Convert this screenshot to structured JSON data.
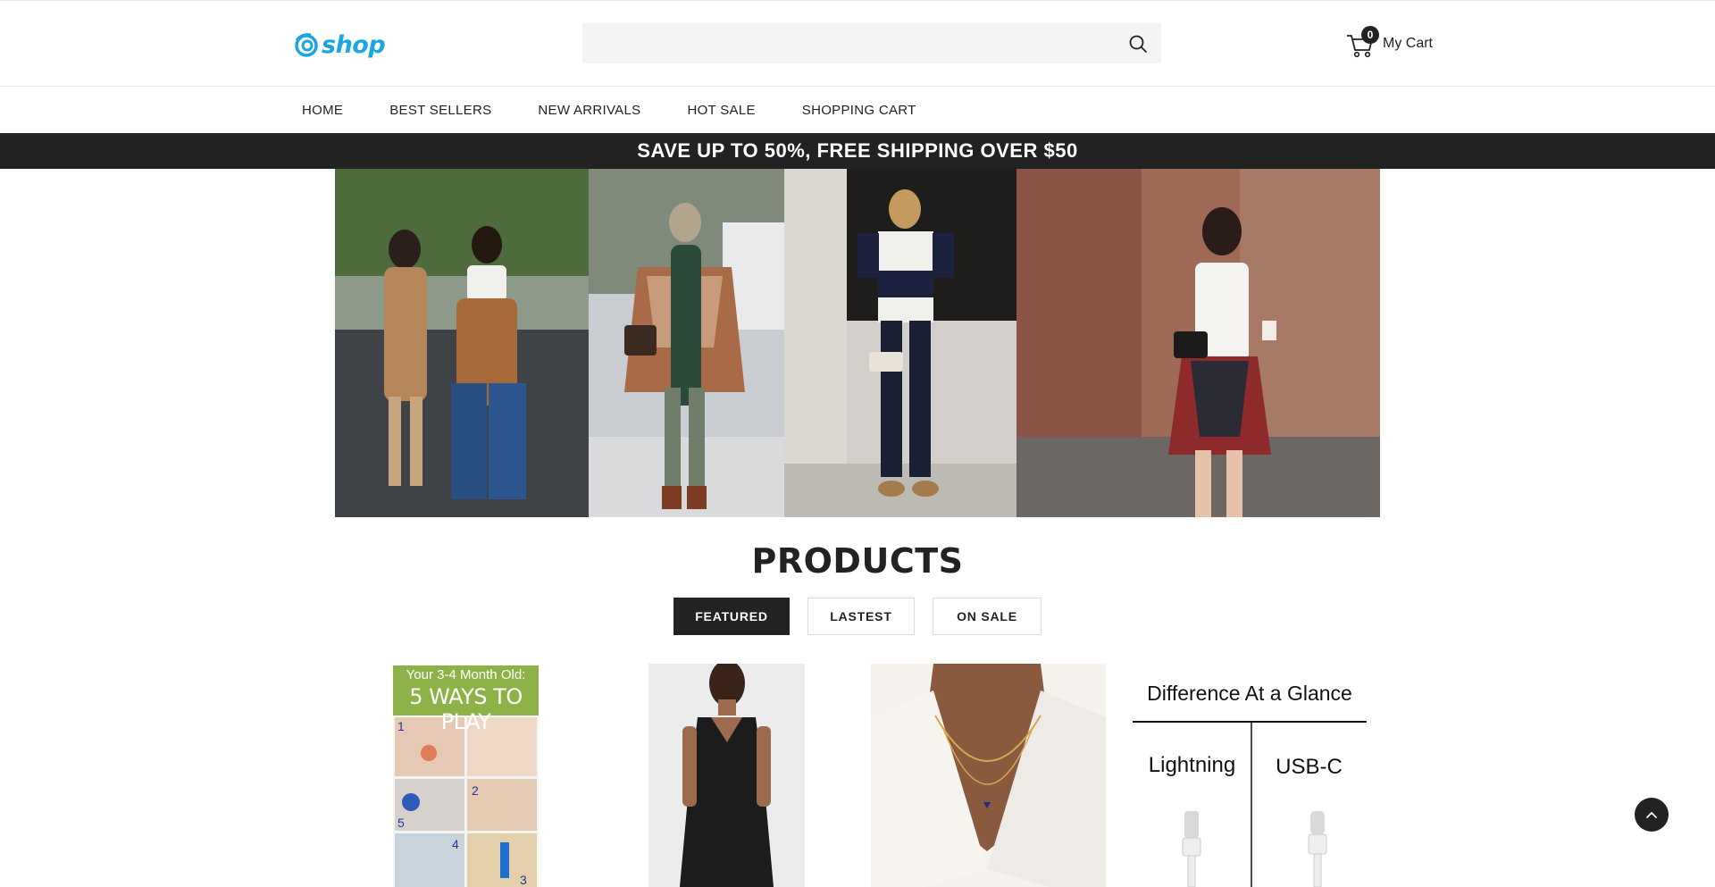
{
  "header": {
    "logo_text": "shop",
    "brand_color": "#1ba6df",
    "search": {
      "placeholder": "",
      "value": "",
      "icon": "search-icon"
    },
    "cart": {
      "count": "0",
      "label": "My Cart",
      "icon": "cart-icon"
    }
  },
  "nav": {
    "items": [
      {
        "label": "HOME"
      },
      {
        "label": "BEST SELLERS"
      },
      {
        "label": "NEW ARRIVALS"
      },
      {
        "label": "HOT SALE"
      },
      {
        "label": "SHOPPING CART"
      }
    ]
  },
  "promo": {
    "text": "SAVE UP TO 50%, FREE SHIPPING OVER $50"
  },
  "hero": {
    "tiles": 4
  },
  "products": {
    "title": "PRODUCTS",
    "tabs": [
      {
        "label": "FEATURED",
        "active": true
      },
      {
        "label": "LASTEST",
        "active": false
      },
      {
        "label": "ON SALE",
        "active": false
      }
    ],
    "items": [
      {
        "heading": "Your 3-4 Month Old:",
        "subheading": "5 WAYS TO PLAY",
        "numbers": [
          "1",
          "2",
          "5",
          "4",
          "3"
        ]
      },
      {
        "alt": "black dress"
      },
      {
        "alt": "heart necklace"
      },
      {
        "heading": "Difference At a Glance",
        "col_left": "Lightning",
        "col_right": "USB-C"
      }
    ]
  },
  "back_to_top": {
    "icon": "chevron-up-icon"
  }
}
